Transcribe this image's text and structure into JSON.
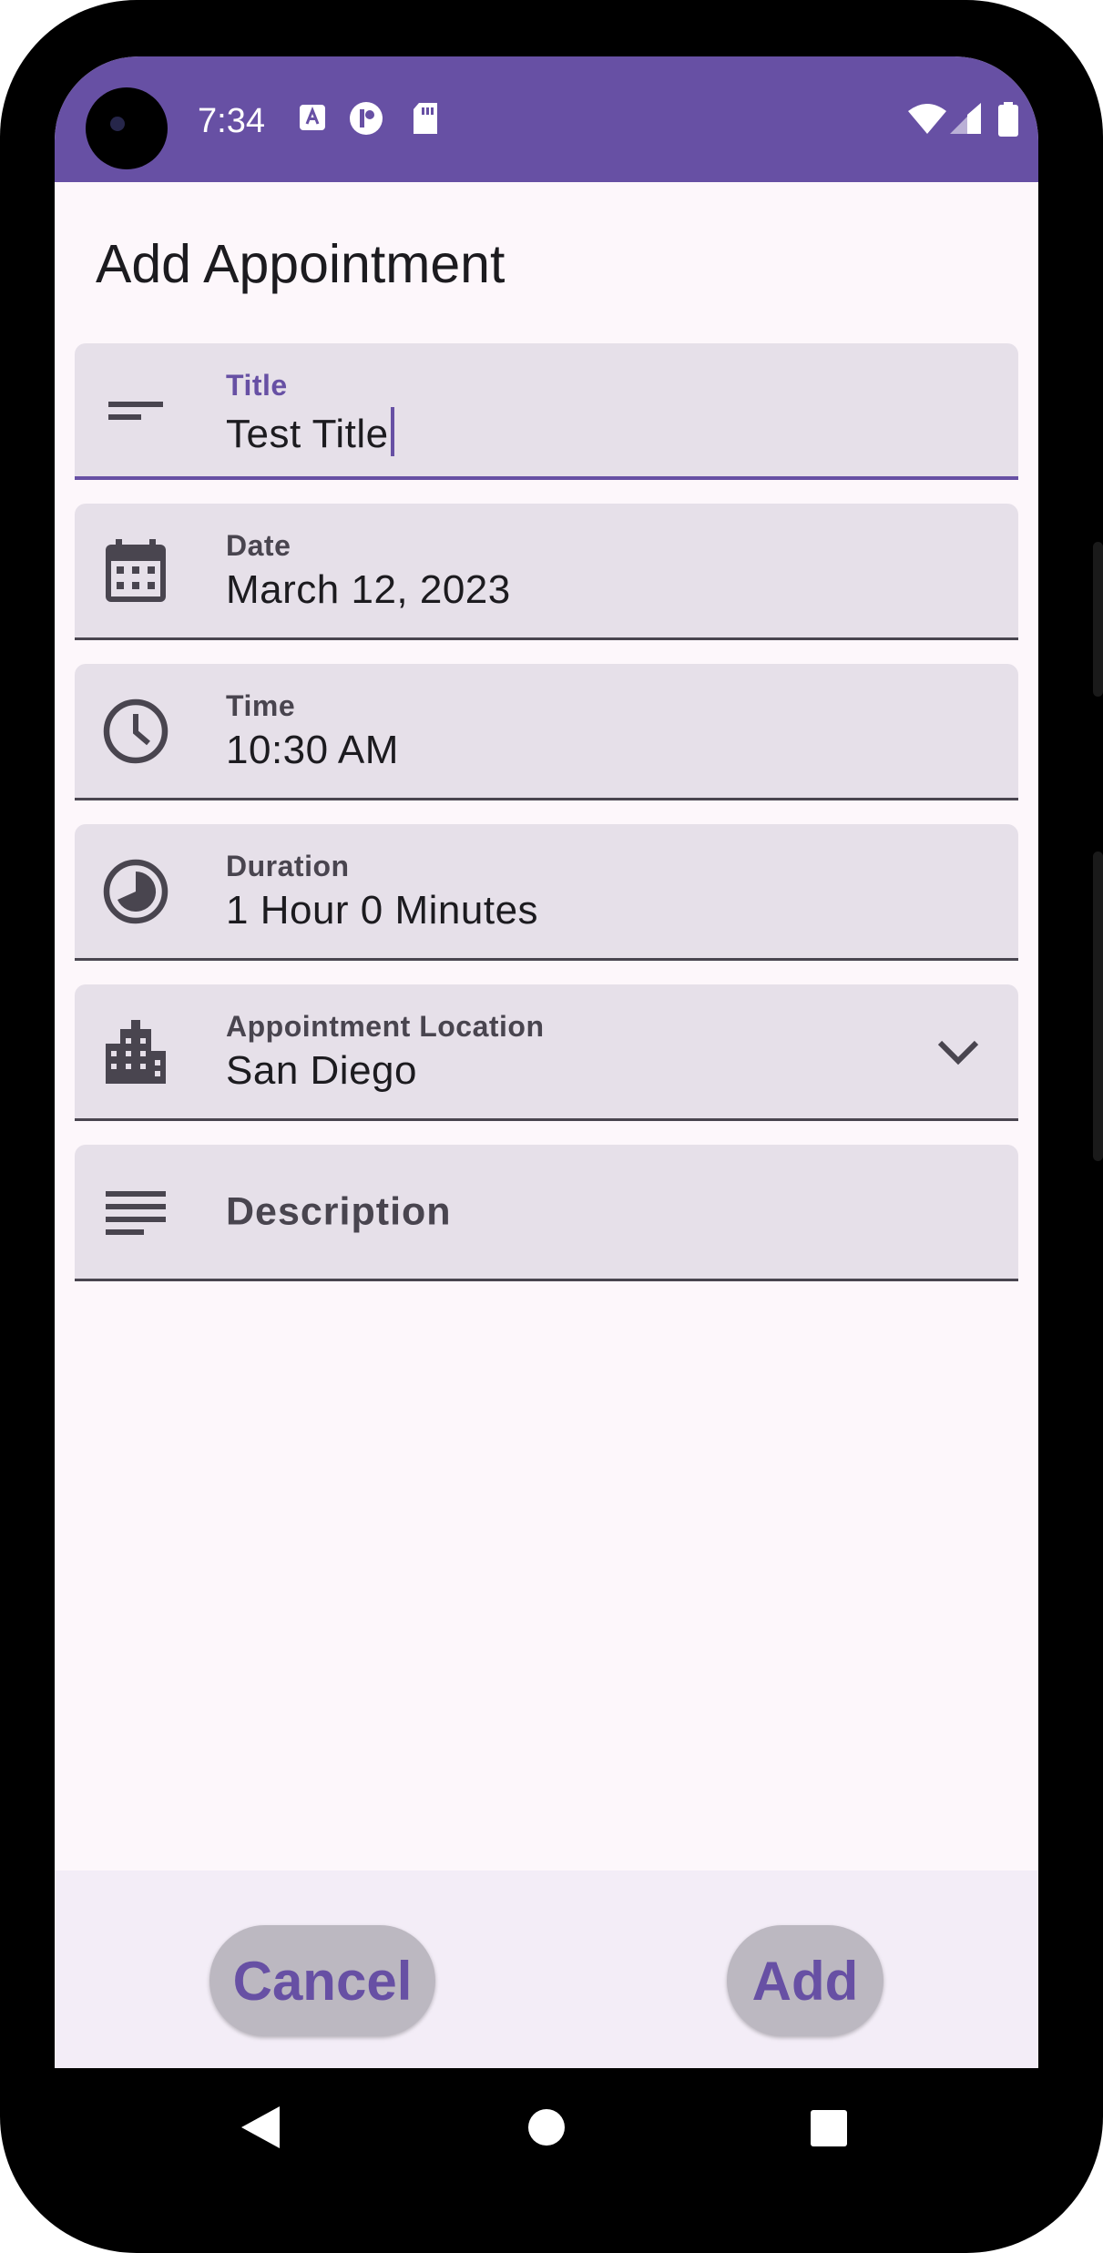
{
  "status_bar": {
    "time": "7:34",
    "left_icons": [
      "a-notification-icon",
      "circle-app-icon",
      "sd-card-icon"
    ],
    "right_icons": [
      "wifi-icon",
      "cell-signal-icon",
      "battery-icon"
    ],
    "color": "#6750a4"
  },
  "page": {
    "title": "Add Appointment"
  },
  "fields": {
    "title": {
      "label": "Title",
      "value": "Test Title",
      "icon": "short-text-icon"
    },
    "date": {
      "label": "Date",
      "value": "March 12, 2023",
      "icon": "calendar-icon"
    },
    "time": {
      "label": "Time",
      "value": "10:30 AM",
      "icon": "clock-icon"
    },
    "duration": {
      "label": "Duration",
      "value": "1 Hour 0 Minutes",
      "icon": "pie-timer-icon"
    },
    "location": {
      "label": "Appointment Location",
      "value": "San Diego",
      "icon": "building-icon",
      "trailing_icon": "chevron-down-icon"
    },
    "description": {
      "placeholder": "Description",
      "icon": "notes-icon"
    }
  },
  "actions": {
    "cancel": "Cancel",
    "add": "Add"
  },
  "navigation": [
    "back-icon",
    "home-icon",
    "recents-icon"
  ],
  "colors": {
    "accent": "#6750a4",
    "field_bg": "#e6e0e9",
    "surface": "#fdf7fb",
    "button_bg": "#bcb8c1"
  }
}
